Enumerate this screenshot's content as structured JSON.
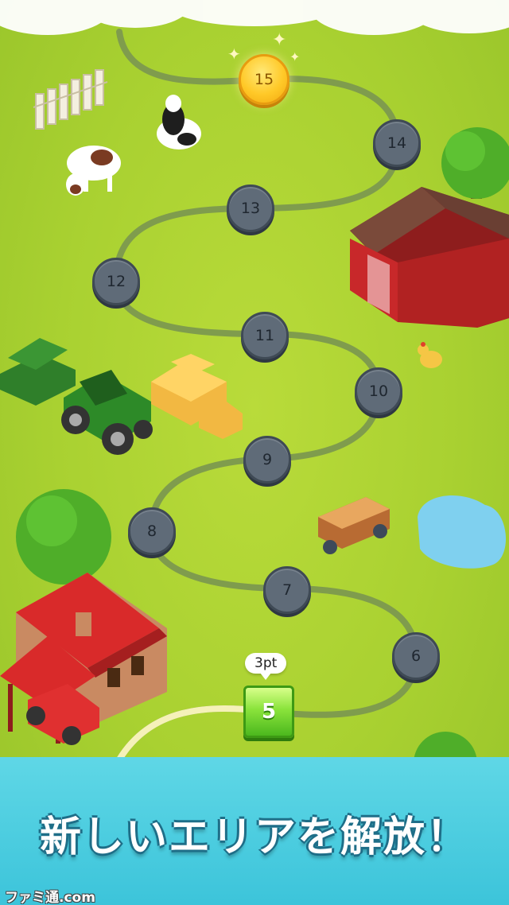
{
  "levels": [
    {
      "id": "level-6",
      "label": "6"
    },
    {
      "id": "level-7",
      "label": "7"
    },
    {
      "id": "level-8",
      "label": "8"
    },
    {
      "id": "level-9",
      "label": "9"
    },
    {
      "id": "level-10",
      "label": "10"
    },
    {
      "id": "level-11",
      "label": "11"
    },
    {
      "id": "level-12",
      "label": "12"
    },
    {
      "id": "level-13",
      "label": "13"
    },
    {
      "id": "level-14",
      "label": "14"
    },
    {
      "id": "level-15",
      "label": "15"
    }
  ],
  "current_level": {
    "label": "5",
    "points": "3pt"
  },
  "banner": {
    "title": "新しいエリアを解放！"
  },
  "watermark": {
    "text": "ファミ通.com"
  },
  "colors": {
    "grass": "#a9d131",
    "path": "#7b9a4a",
    "node": "#5f6b78",
    "banner": "#4ccde0",
    "barn": "#c8282a"
  }
}
